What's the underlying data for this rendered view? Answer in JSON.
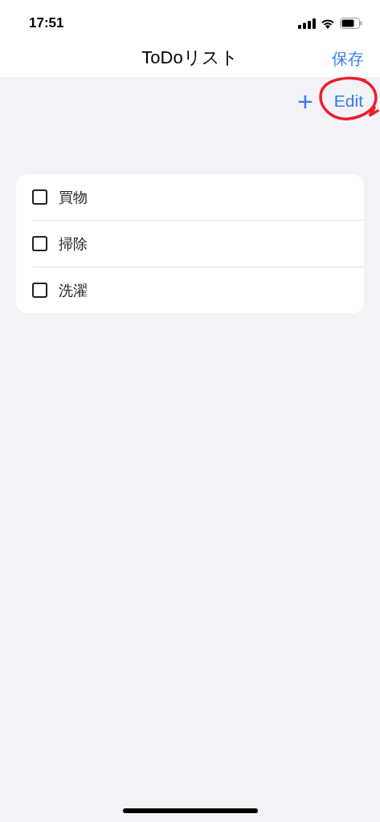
{
  "status_bar": {
    "time": "17:51"
  },
  "nav_bar": {
    "title": "ToDoリスト",
    "save_button": "保存"
  },
  "toolbar": {
    "add_button": "+",
    "edit_button": {
      "label": "Edit",
      "circled": true
    }
  },
  "todos": [
    {
      "label": "買物",
      "checked": false
    },
    {
      "label": "掃除",
      "checked": false
    },
    {
      "label": "洗濯",
      "checked": false
    }
  ]
}
